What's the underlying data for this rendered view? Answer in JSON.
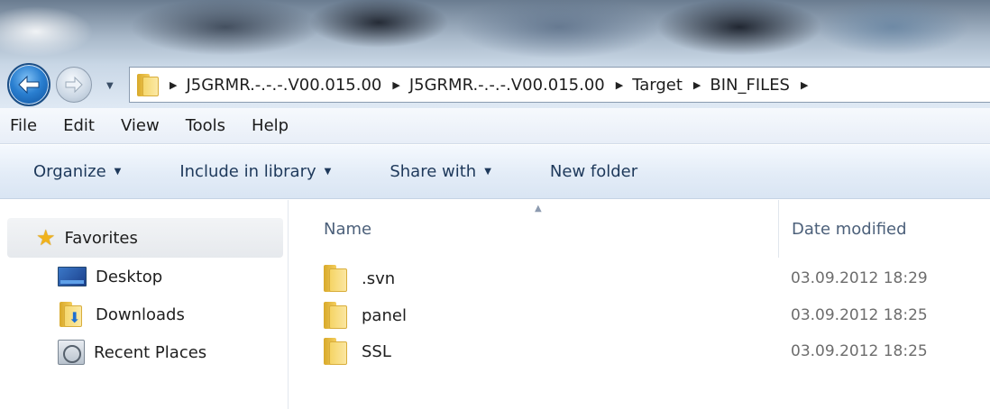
{
  "address_bar": {
    "breadcrumbs": [
      "J5GRMR.-.-.-.V00.015.00",
      "J5GRMR.-.-.-.V00.015.00",
      "Target",
      "BIN_FILES"
    ]
  },
  "menu": {
    "items": [
      "File",
      "Edit",
      "View",
      "Tools",
      "Help"
    ]
  },
  "toolbar": {
    "organize_label": "Organize",
    "include_label": "Include in library",
    "share_label": "Share with",
    "new_folder_label": "New folder"
  },
  "nav_pane": {
    "favorites_label": "Favorites",
    "items": [
      "Desktop",
      "Downloads",
      "Recent Places"
    ]
  },
  "file_list": {
    "columns": {
      "name": "Name",
      "date": "Date modified"
    },
    "rows": [
      {
        "name": ".svn",
        "date": "03.09.2012 18:29"
      },
      {
        "name": "panel",
        "date": "03.09.2012 18:25"
      },
      {
        "name": "SSL",
        "date": "03.09.2012 18:25"
      }
    ]
  },
  "colors": {
    "accent": "#1e395b",
    "header_text": "#4c607a",
    "date_text": "#6d6d6d",
    "folder": "#f4cd5c"
  }
}
